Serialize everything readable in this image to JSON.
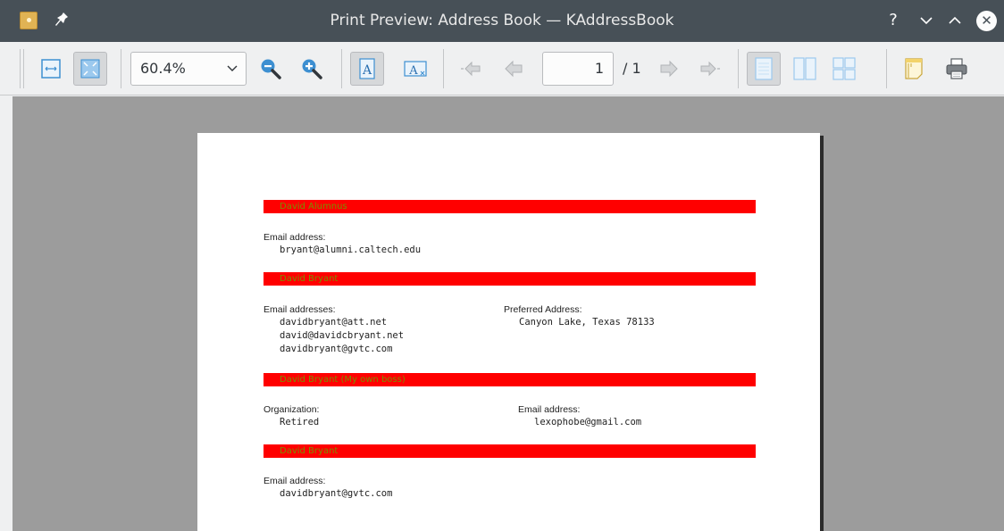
{
  "window": {
    "title": "Print Preview: Address Book — KAddressBook"
  },
  "titlebar_buttons": {
    "help": "?",
    "minimize": "⌄",
    "maximize": "^",
    "close": "✕"
  },
  "toolbar": {
    "zoom_value": "60.4%",
    "page_current": "1",
    "page_total": "/ 1"
  },
  "contacts": [
    {
      "name": "David Alumnus",
      "fields": [
        {
          "label": "Email address:",
          "values": [
            "bryant@alumni.caltech.edu"
          ]
        }
      ]
    },
    {
      "name": "David Bryant",
      "fields": [
        {
          "label": "Email addresses:",
          "values": [
            "davidbryant@att.net",
            "david@davidcbryant.net",
            "davidbryant@gvtc.com"
          ]
        },
        {
          "label": "Preferred Address:",
          "values": [
            "Canyon Lake, Texas 78133"
          ]
        }
      ]
    },
    {
      "name": "David Bryant (My own boss)",
      "fields": [
        {
          "label": "Organization:",
          "values": [
            "Retired"
          ]
        },
        {
          "label": "Email address:",
          "values": [
            "lexophobe@gmail.com"
          ]
        }
      ]
    },
    {
      "name": "David Bryant",
      "fields": [
        {
          "label": "Email address:",
          "values": [
            "davidbryant@gvtc.com"
          ]
        }
      ]
    }
  ],
  "colors": {
    "titlebar": "#475057",
    "contact_bar": "#ff0000",
    "contact_name": "#7a8f00",
    "canvas": "#9c9c9c"
  }
}
